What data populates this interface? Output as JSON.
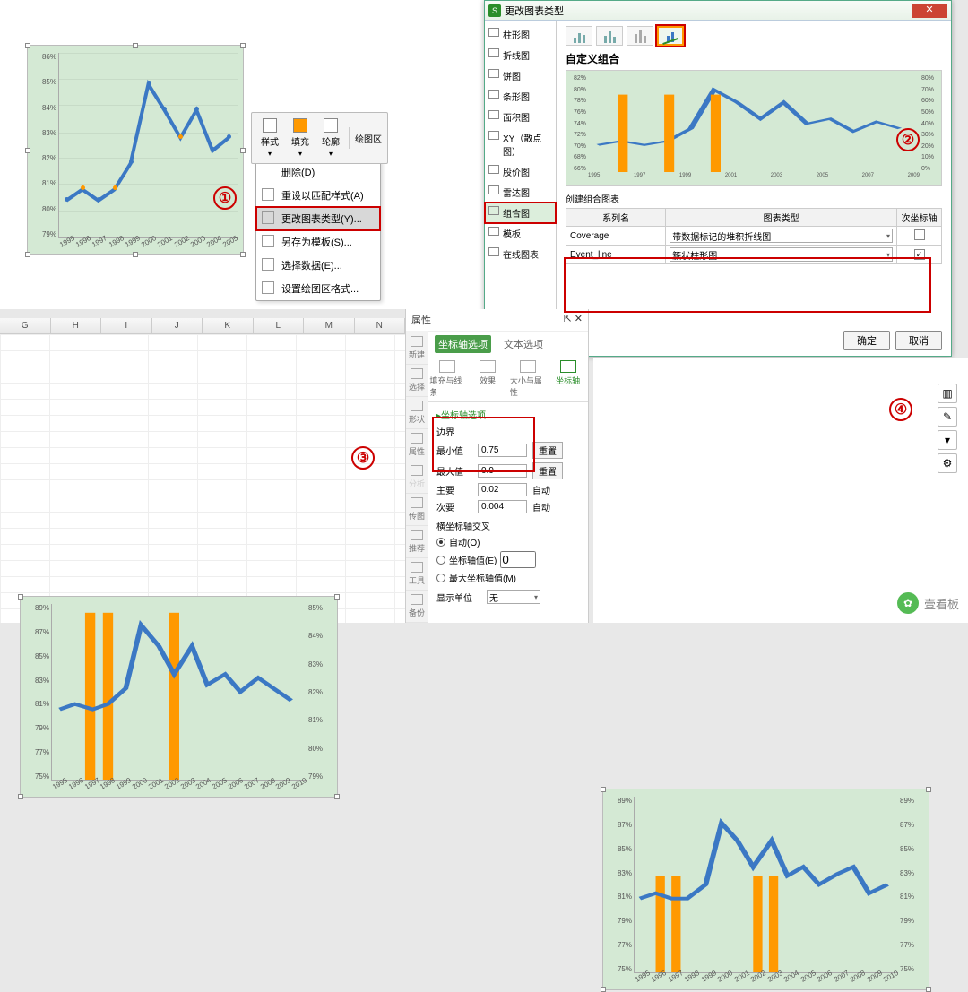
{
  "badges": {
    "s1": "①",
    "s2": "②",
    "s3": "③",
    "s4": "④"
  },
  "mini_toolbar": {
    "style": "样式",
    "fill": "填充",
    "outline": "轮廓",
    "area": "绘图区"
  },
  "context_menu": {
    "delete": "删除(D)",
    "reset": "重设以匹配样式(A)",
    "change_type": "更改图表类型(Y)...",
    "save_template": "另存为模板(S)...",
    "select_data": "选择数据(E)...",
    "format_plot": "设置绘图区格式..."
  },
  "dialog": {
    "title": "更改图表类型",
    "nav": {
      "column": "柱形图",
      "line": "折线图",
      "pie": "饼图",
      "bar": "条形图",
      "area": "面积图",
      "xy": "XY（散点图）",
      "stock": "股价图",
      "radar": "雷达图",
      "combo": "组合图",
      "template": "模板",
      "online": "在线图表"
    },
    "section": "自定义组合",
    "create_title": "创建组合图表",
    "th_series": "系列名",
    "th_type": "图表类型",
    "th_secondary": "次坐标轴",
    "series1": "Coverage",
    "series1_type": "带数据标记的堆积折线图",
    "series2": "Event_line",
    "series2_type": "簇状柱形图",
    "ok": "确定",
    "cancel": "取消"
  },
  "prop": {
    "title": "属性",
    "tabs": {
      "axis": "坐标轴选项",
      "text": "文本选项"
    },
    "sub": {
      "fill": "填充与线条",
      "effects": "效果",
      "size": "大小与属性",
      "axis": "坐标轴"
    },
    "sect_axis": "▸坐标轴选项",
    "bounds": "边界",
    "min": "最小值",
    "max": "最大值",
    "min_v": "0.75",
    "max_v": "0.9",
    "reset": "重置",
    "major": "主要",
    "minor": "次要",
    "major_v": "0.02",
    "minor_v": "0.004",
    "auto": "自动",
    "cross": "横坐标轴交叉",
    "auto_o": "自动(O)",
    "axis_val": "坐标轴值(E)",
    "axis_val_v": "0",
    "max_val": "最大坐标轴值(M)",
    "units": "显示单位",
    "units_v": "无",
    "side": {
      "new": "新建",
      "select": "选择",
      "shape": "形状",
      "prop": "属性",
      "analyze": "分析",
      "legend": "传图",
      "recommend": "推荐",
      "tools": "工具",
      "backup": "备份"
    }
  },
  "sheet_cols": [
    "G",
    "H",
    "I",
    "J",
    "K",
    "L",
    "M",
    "N"
  ],
  "watermark": "壹看板",
  "chart_data": {
    "type": "line",
    "categories": [
      "1995",
      "1996",
      "1997",
      "1998",
      "1999",
      "2000",
      "2001",
      "2002",
      "2003",
      "2004",
      "2005"
    ],
    "series": [
      {
        "name": "Coverage",
        "values": [
          0.805,
          0.81,
          0.805,
          0.81,
          0.82,
          0.85,
          0.84,
          0.83,
          0.84,
          0.825,
          0.83
        ]
      }
    ],
    "ylabel": "",
    "xlabel": "",
    "ylim_p1": [
      0.79,
      0.86
    ],
    "ylim_p3_left": [
      0.75,
      0.89
    ],
    "ylim_p3_right": [
      0.79,
      0.85
    ],
    "event_bars": {
      "p3": [
        "1997",
        "1998",
        "2002"
      ],
      "p4": [
        "1996",
        "1997",
        "2002",
        "2003"
      ]
    },
    "p4_categories": [
      "1995",
      "1996",
      "1997",
      "1998",
      "1999",
      "2000",
      "2001",
      "2002",
      "2003",
      "2004",
      "2005",
      "2006",
      "2007",
      "2008",
      "2009",
      "2010"
    ],
    "p4_values": [
      0.81,
      0.815,
      0.81,
      0.81,
      0.82,
      0.85,
      0.84,
      0.83,
      0.84,
      0.825,
      0.83,
      0.82,
      0.825,
      0.83,
      0.815,
      0.82
    ]
  }
}
